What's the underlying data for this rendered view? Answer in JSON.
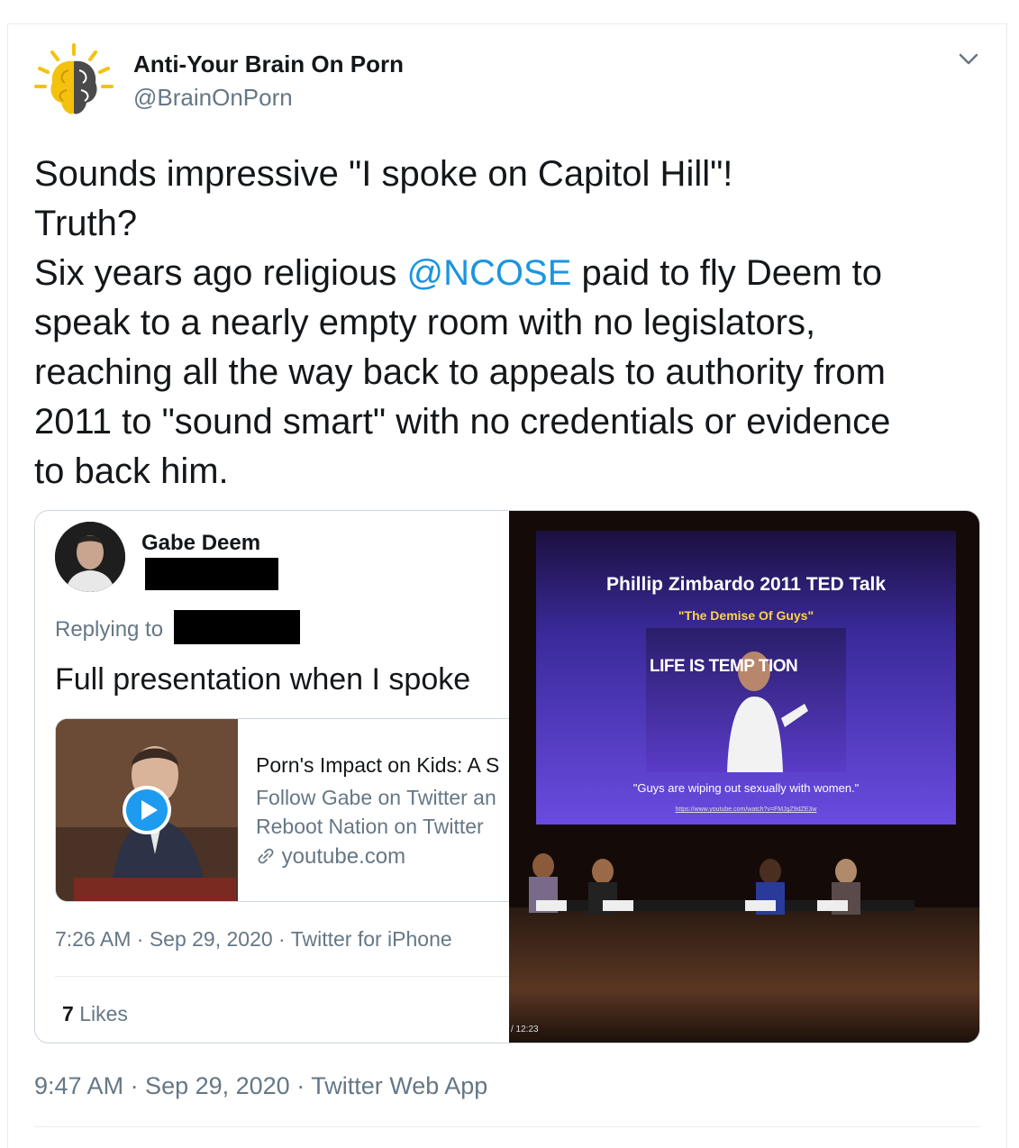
{
  "author": {
    "name": "Anti-Your Brain On Porn",
    "handle": "@BrainOnPorn"
  },
  "tweet": {
    "line1": "Sounds impressive \"I spoke on Capitol Hill\"!",
    "line2": "Truth?",
    "line3_before": "Six years ago religious ",
    "mention": "@NCOSE",
    "line3_after": " paid to fly Deem to",
    "line4": "speak to a nearly empty room with no legislators,",
    "line5": "reaching all the way back to appeals to authority from",
    "line6": "2011 to \"sound smart\" with no credentials or evidence",
    "line7": "to back him."
  },
  "embedded_tweet": {
    "name": "Gabe Deem",
    "replying_label": "Replying to",
    "text": "Full presentation when I spoke",
    "card": {
      "title": "Porn's Impact on Kids: A S",
      "desc_line1": "Follow Gabe on Twitter an",
      "desc_line2": "Reboot Nation on Twitter",
      "link": "youtube.com"
    },
    "meta": "7:26 AM · Sep 29, 2020 · Twitter for iPhone",
    "likes_count": "7",
    "likes_label": "Likes"
  },
  "video": {
    "slide_title": "Phillip Zimbardo 2011 TED Talk",
    "slide_subtitle": "\"The Demise Of Guys\"",
    "slide_overlay": "LIFE IS TEMP   TION",
    "slide_quote": "\"Guys are wiping out sexually with women.\"",
    "slide_url": "https://www.youtube.com/watch?v=FMJgZ9dZE3w",
    "duration": "/ 12:23"
  },
  "footer": {
    "meta": "9:47 AM · Sep 29, 2020 · Twitter Web App"
  },
  "colors": {
    "text": "#14171a",
    "secondary": "#657786",
    "link": "#1b95e0",
    "border": "#ccd6dd"
  }
}
